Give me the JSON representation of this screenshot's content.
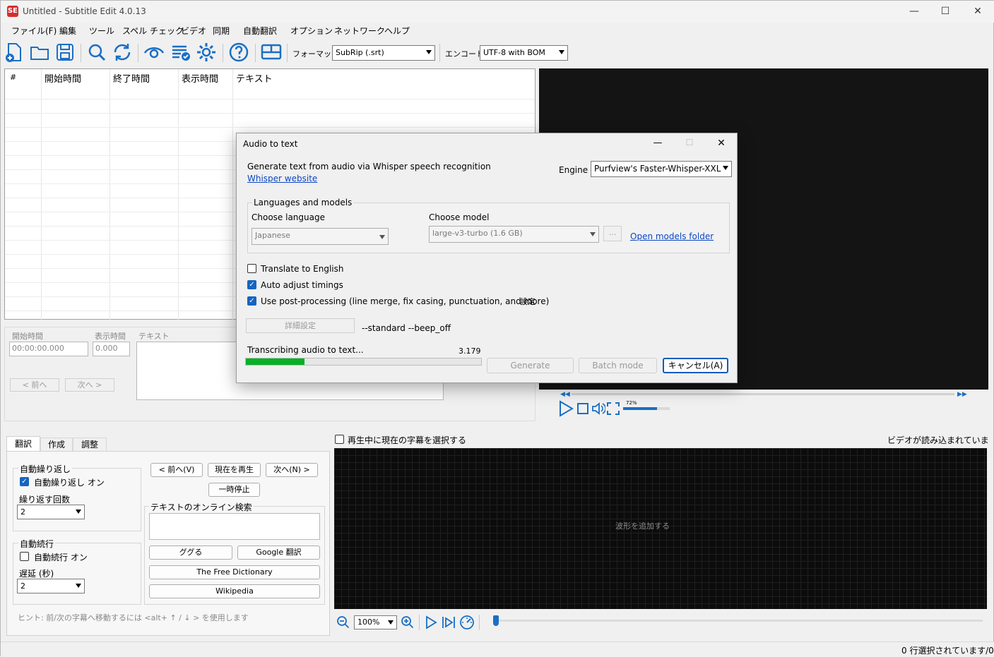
{
  "window": {
    "title": "Untitled - Subtitle Edit 4.0.13",
    "app_icon_label": "SE",
    "minimize": "—",
    "maximize": "☐",
    "close": "✕"
  },
  "menu": [
    "ファイル(F)",
    "編集",
    "ツール",
    "スペル チェック",
    "ビデオ",
    "同期",
    "自動翻訳",
    "オプション",
    "ネットワーク",
    "ヘルプ"
  ],
  "toolbar": {
    "format_label": "フォーマット",
    "format_value": "SubRip (.srt)",
    "encoding_label": "エンコード",
    "encoding_value": "UTF-8 with BOM"
  },
  "grid": {
    "headers": [
      "#",
      "開始時間",
      "終了時間",
      "表示時間",
      "テキスト"
    ]
  },
  "edit": {
    "start_label": "開始時間",
    "start_value": "00:00:00.000",
    "duration_label": "表示時間",
    "duration_value": "0.000",
    "text_label": "テキスト",
    "prev": "< 前へ",
    "next": "次へ >"
  },
  "video": {
    "volume_pct": "72%",
    "volume_level": 0.72
  },
  "dialog": {
    "title": "Audio to text",
    "description": "Generate text from audio via Whisper speech recognition",
    "website_link": "Whisper website",
    "engine_label": "Engine",
    "engine_value": "Purfview's Faster-Whisper-XXL",
    "group_label": "Languages and models",
    "language_label": "Choose language",
    "language_value": "Japanese",
    "model_label": "Choose model",
    "model_value": "large-v3-turbo (1.6 GB)",
    "browse": "...",
    "models_folder_link": "Open models folder",
    "translate_label": "Translate to English",
    "translate_checked": false,
    "auto_adjust_label": "Auto adjust timings",
    "auto_adjust_checked": true,
    "post_processing_label": "Use post-processing (line merge, fix casing, punctuation, and more)",
    "post_processing_checked": true,
    "post_processing_settings": "設定",
    "advanced_button": "詳細設定",
    "advanced_args": "--standard --beep_off",
    "progress_text": "Transcribing audio to text...",
    "progress_value": "3.179",
    "progress_fraction": 0.25,
    "generate": "Generate",
    "batch_mode": "Batch mode",
    "cancel": "キャンセル(A)",
    "check": "✓"
  },
  "bottom_tabs": [
    "翻訳",
    "作成",
    "調整"
  ],
  "translate_panel": {
    "auto_repeat_group": "自動繰り返し",
    "auto_repeat_on": "自動繰り返し オン",
    "repeat_count_label": "繰り返す回数",
    "repeat_count_value": "2",
    "auto_continue_group": "自動続行",
    "auto_continue_on": "自動続行 オン",
    "delay_label": "遅延 (秒)",
    "delay_value": "2",
    "prev_button": "< 前へ(V)",
    "play_current": "現在を再生",
    "next_button": "次へ(N) >",
    "pause": "一時停止",
    "search_group": "テキストのオンライン検索",
    "google_it": "ググる",
    "google_translate": "Google 翻訳",
    "free_dictionary": "The Free Dictionary",
    "wikipedia": "Wikipedia",
    "hint": "ヒント: 前/次の字幕へ移動するには <alt+ ↑ / ↓ > を使用します"
  },
  "waveform": {
    "select_current_label": "再生中に現在の字幕を選択する",
    "no_video": "ビデオが読み込まれていません",
    "add_waveform": "波形を追加する",
    "zoom_value": "100%"
  },
  "status": {
    "selected": "0 行選択されています/0"
  }
}
